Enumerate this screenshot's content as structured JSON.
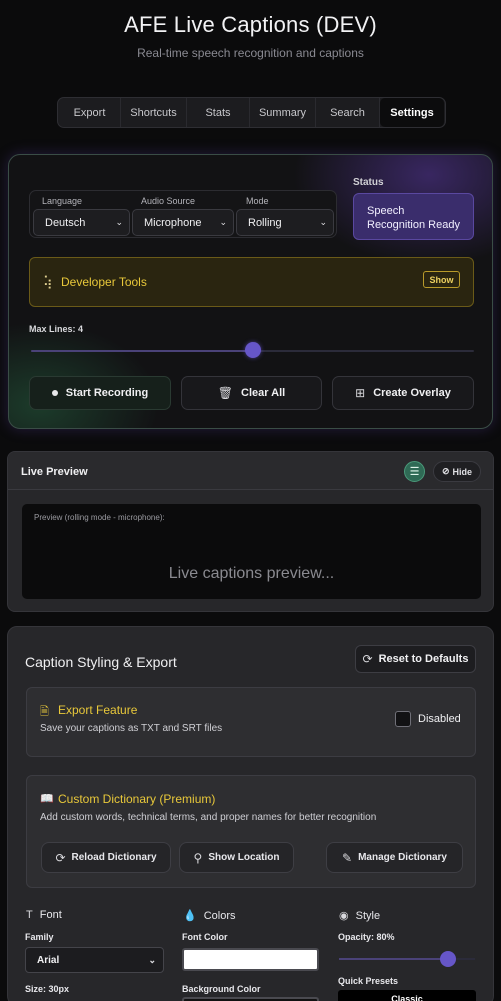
{
  "header": {
    "title": "AFE Live Captions (DEV)",
    "subtitle": "Real-time speech recognition and captions"
  },
  "tabs": [
    {
      "label": "Export",
      "active": false
    },
    {
      "label": "Shortcuts",
      "active": false
    },
    {
      "label": "Stats",
      "active": false
    },
    {
      "label": "Summary",
      "active": false
    },
    {
      "label": "Search",
      "active": false
    },
    {
      "label": "Settings",
      "active": true
    }
  ],
  "controls": {
    "language": {
      "label": "Language",
      "value": "Deutsch"
    },
    "audio_source": {
      "label": "Audio Source",
      "value": "Microphone"
    },
    "mode": {
      "label": "Mode",
      "value": "Rolling"
    },
    "status": {
      "label": "Status",
      "value": "Speech Recognition Ready"
    },
    "developer_tools": {
      "label": "Developer Tools",
      "button": "Show"
    },
    "max_lines": {
      "label": "Max Lines: 4",
      "value": 4,
      "min": 1,
      "max": 7
    },
    "actions": {
      "start": "Start Recording",
      "clear": "Clear All",
      "overlay": "Create Overlay"
    }
  },
  "preview": {
    "title": "Live Preview",
    "hide_label": "Hide",
    "hint": "Preview (rolling mode - microphone):",
    "placeholder": "Live captions preview..."
  },
  "styling": {
    "title": "Caption Styling & Export",
    "reset_label": "Reset to Defaults",
    "export": {
      "title": "Export Feature",
      "desc": "Save your captions as TXT and SRT files",
      "toggle_label": "Disabled",
      "enabled": false
    },
    "dictionary": {
      "title": "Custom Dictionary (Premium)",
      "desc": "Add custom words, technical terms, and proper names for better recognition",
      "reload": "Reload Dictionary",
      "show_location": "Show Location",
      "manage": "Manage Dictionary"
    },
    "font": {
      "title": "Font",
      "family_label": "Family",
      "family_value": "Arial",
      "size_label": "Size: 30px"
    },
    "colors": {
      "title": "Colors",
      "font_color_label": "Font Color",
      "font_color": "#ffffff",
      "bg_color_label": "Background Color"
    },
    "style": {
      "title": "Style",
      "opacity_label": "Opacity: 80%",
      "opacity": 0.8,
      "presets_label": "Quick Presets",
      "preset_classic": "Classic"
    }
  },
  "colors": {
    "accent_purple": "#6656c8",
    "status_bg": "#3a2d6c",
    "dev_tools_yellow": "#e8c83a",
    "layers_green": "#2f6a55"
  }
}
